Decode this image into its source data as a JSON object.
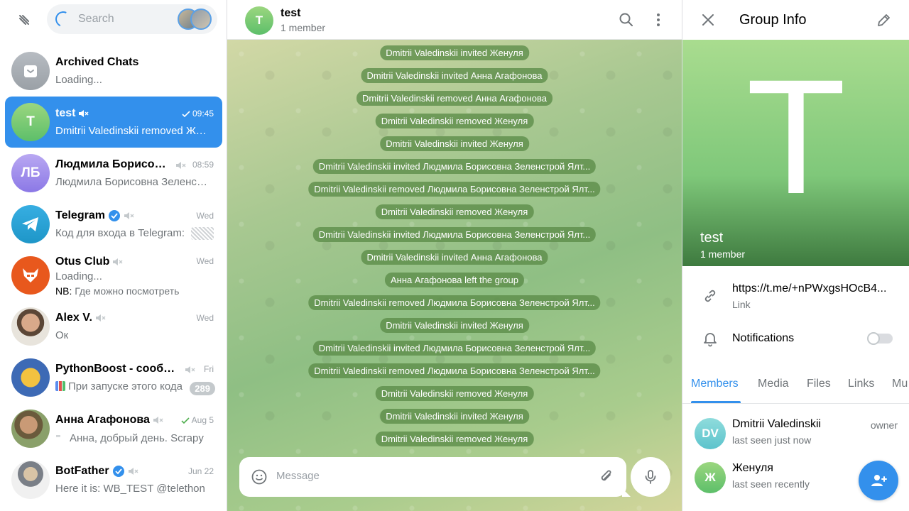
{
  "sidebar": {
    "search_placeholder": "Search",
    "chats": [
      {
        "title": "Archived Chats",
        "subtitle": "Loading...",
        "time": ""
      },
      {
        "title": "test",
        "subtitle": "Dmitrii Valedinskii removed Женуля",
        "time": "09:45",
        "avatar_letter": "T"
      },
      {
        "title": "Людмила Борисовна Зеленстрой Ялтинская",
        "subtitle": "Людмила Борисовна Зеленстрой Ялтинская",
        "time": "08:59",
        "avatar_letter": "ЛБ"
      },
      {
        "title": "Telegram",
        "subtitle": "Код для входа в Telegram:",
        "time": "Wed"
      },
      {
        "title": "Otus Club",
        "subtitle": "Loading...",
        "subtitle2_prefix": "NB:",
        "subtitle2": " Где можно посмотреть",
        "time": "Wed"
      },
      {
        "title": "Alex V.",
        "subtitle": "Ок",
        "time": "Wed"
      },
      {
        "title": "PythonBoost - сообщество",
        "subtitle": "При запуске этого кода",
        "time": "Fri",
        "badge": "289"
      },
      {
        "title": "Анна Агафонова",
        "subtitle": "Анна, добрый день. Scrapy",
        "time": "Aug 5"
      },
      {
        "title": "BotFather",
        "subtitle": "Here it is: WB_TEST @telethon",
        "time": "Jun 22"
      }
    ]
  },
  "chat": {
    "title": "test",
    "subtitle": "1 member",
    "avatar_letter": "T",
    "messages": [
      "Dmitrii Valedinskii invited Женуля",
      "Dmitrii Valedinskii invited Анна Агафонова",
      "Dmitrii Valedinskii removed Анна Агафонова",
      "Dmitrii Valedinskii removed Женуля",
      "Dmitrii Valedinskii invited Женуля",
      "Dmitrii Valedinskii invited Людмила Борисовна Зеленстрой Ялт...",
      "Dmitrii Valedinskii removed Людмила Борисовна Зеленстрой Ялт...",
      "Dmitrii Valedinskii removed Женуля",
      "Dmitrii Valedinskii invited Людмила Борисовна Зеленстрой Ялт...",
      "Dmitrii Valedinskii invited Анна Агафонова",
      "Анна Агафонова left the group",
      "Dmitrii Valedinskii removed Людмила Борисовна Зеленстрой Ялт...",
      "Dmitrii Valedinskii invited Женуля",
      "Dmitrii Valedinskii invited Людмила Борисовна Зеленстрой Ялт...",
      "Dmitrii Valedinskii removed Людмила Борисовна Зеленстрой Ялт...",
      "Dmitrii Valedinskii removed Женуля",
      "Dmitrii Valedinskii invited Женуля",
      "Dmitrii Valedinskii removed Женуля"
    ],
    "composer_placeholder": "Message"
  },
  "info": {
    "title": "Group Info",
    "hero_letter": "T",
    "group_name": "test",
    "group_sub": "1 member",
    "link": "https://t.me/+nPWxgsHOcB4...",
    "link_label": "Link",
    "notifications_label": "Notifications",
    "tabs": [
      "Members",
      "Media",
      "Files",
      "Links",
      "Mu"
    ],
    "members": [
      {
        "initials": "DV",
        "name": "Dmitrii Valedinskii",
        "status": "last seen just now",
        "role": "owner"
      },
      {
        "initials": "Ж",
        "name": "Женуля",
        "status": "last seen recently",
        "role": ""
      }
    ]
  },
  "colors": {
    "accent": "#3390ec",
    "muted": "#707579",
    "chat_bg": "#a8c891",
    "system_msg": "#5b8c48"
  },
  "icons": [
    "menu-icon",
    "search-icon",
    "more-icon",
    "mute-icon",
    "verified-icon",
    "check-icon",
    "emoji-icon",
    "attach-icon",
    "mic-icon",
    "close-icon",
    "edit-icon",
    "link-icon",
    "bell-icon",
    "add-member-icon"
  ]
}
